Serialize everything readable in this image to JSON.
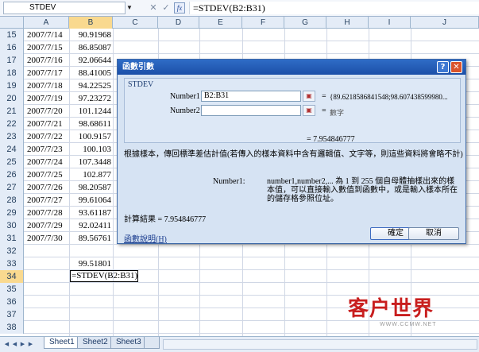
{
  "formula_bar": {
    "name_box": "STDEV",
    "cancel_glyph": "✕",
    "enter_glyph": "✓",
    "fx_label": "fx",
    "formula": "=STDEV(B2:B31)"
  },
  "columns": [
    "A",
    "B",
    "C",
    "D",
    "E",
    "F",
    "G",
    "H",
    "I",
    "J"
  ],
  "rows": [
    {
      "num": "15",
      "a": "2007/7/14",
      "b": "90.91968"
    },
    {
      "num": "16",
      "a": "2007/7/15",
      "b": "86.85087"
    },
    {
      "num": "17",
      "a": "2007/7/16",
      "b": "92.06644"
    },
    {
      "num": "18",
      "a": "2007/7/17",
      "b": "88.41005"
    },
    {
      "num": "19",
      "a": "2007/7/18",
      "b": "94.22525"
    },
    {
      "num": "20",
      "a": "2007/7/19",
      "b": "97.23272"
    },
    {
      "num": "21",
      "a": "2007/7/20",
      "b": "101.1244"
    },
    {
      "num": "22",
      "a": "2007/7/21",
      "b": "98.68611"
    },
    {
      "num": "23",
      "a": "2007/7/22",
      "b": "100.9157"
    },
    {
      "num": "24",
      "a": "2007/7/23",
      "b": "100.103"
    },
    {
      "num": "25",
      "a": "2007/7/24",
      "b": "107.3448"
    },
    {
      "num": "26",
      "a": "2007/7/25",
      "b": "102.877"
    },
    {
      "num": "27",
      "a": "2007/7/26",
      "b": "98.20587"
    },
    {
      "num": "28",
      "a": "2007/7/27",
      "b": "99.61064"
    },
    {
      "num": "29",
      "a": "2007/7/28",
      "b": "93.61187"
    },
    {
      "num": "30",
      "a": "2007/7/29",
      "b": "92.02411"
    },
    {
      "num": "31",
      "a": "2007/7/30",
      "b": "89.56761"
    },
    {
      "num": "32",
      "a": "",
      "b": ""
    },
    {
      "num": "33",
      "a": "",
      "b": "99.51801"
    },
    {
      "num": "34",
      "a": "",
      "b": "=STDEV(B2:B31)"
    },
    {
      "num": "35",
      "a": "",
      "b": ""
    },
    {
      "num": "36",
      "a": "",
      "b": ""
    },
    {
      "num": "37",
      "a": "",
      "b": ""
    },
    {
      "num": "38",
      "a": "",
      "b": ""
    }
  ],
  "dialog": {
    "title": "函數引數",
    "function_name": "STDEV",
    "arg1_label": "Number1",
    "arg1_value": "B2:B31",
    "arg1_result": "{89.6218586841548;98.607438599980...",
    "arg2_label": "Number2",
    "arg2_value": "",
    "arg2_result": "數字",
    "equals": "=",
    "formula_result": "= 7.954846777",
    "description": "根據樣本，傳回標準差估計值(若傳入的樣本資料中含有邏輯值、文字等，則這些資料將會略不計)",
    "arg_desc_label": "Number1:",
    "arg_desc_text": "number1,number2,... 為 1 到 255 個自母體抽樣出來的樣本值，可以直接輸入數值到函數中，或是輸入樣本所在的儲存格參照位址。",
    "calc_result": "計算結果 = 7.954846777",
    "help_link": "函數說明(H)",
    "ok_label": "確定",
    "cancel_label": "取消",
    "help_glyph": "?",
    "close_glyph": "✕"
  },
  "sheet_tabs": [
    "Sheet1",
    "Sheet2",
    "Sheet3"
  ],
  "watermark": {
    "text": "客户世界",
    "sub": "WWW.CCMW.NET"
  }
}
